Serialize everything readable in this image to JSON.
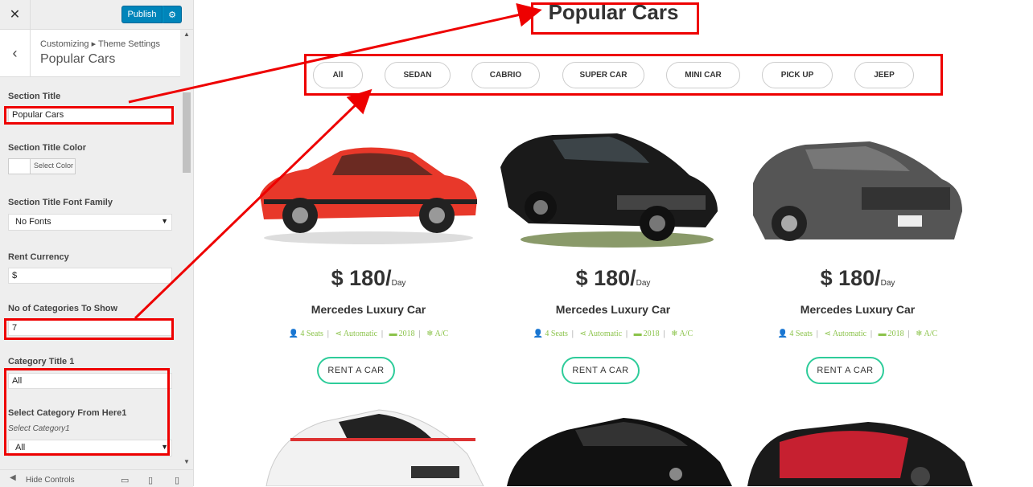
{
  "sidebar": {
    "close_icon": "close-icon",
    "publish_label": "Publish",
    "gear_icon": "gear-icon",
    "breadcrumb": "Customizing ▸ Theme Settings",
    "title": "Popular Cars",
    "fields": {
      "section_title_label": "Section Title",
      "section_title_value": "Popular Cars",
      "section_title_color_label": "Section Title Color",
      "select_color_label": "Select Color",
      "font_family_label": "Section Title Font Family",
      "font_family_value": "No Fonts",
      "rent_currency_label": "Rent Currency",
      "rent_currency_value": "$",
      "categories_label": "No of Categories To Show",
      "categories_value": "7",
      "category_title_label": "Category Title 1",
      "category_title_value": "All",
      "select_category_label": "Select Category From Here1",
      "select_category_sub": "Select Category1",
      "select_category_value": "All"
    },
    "footer": {
      "hide_controls": "Hide Controls"
    }
  },
  "main": {
    "title": "Popular Cars",
    "tabs": [
      "All",
      "SEDAN",
      "CABRIO",
      "SUPER CAR",
      "MINI CAR",
      "PICK UP",
      "JEEP"
    ],
    "cars": [
      {
        "price": "$ 180/",
        "unit": "Day",
        "name": "Mercedes Luxury Car",
        "seats": "4 Seats",
        "transmission": "Automatic",
        "year": "2018",
        "ac": "A/C",
        "button": "RENT A CAR",
        "color": "#e8382a"
      },
      {
        "price": "$ 180/",
        "unit": "Day",
        "name": "Mercedes Luxury Car",
        "seats": "4 Seats",
        "transmission": "Automatic",
        "year": "2018",
        "ac": "A/C",
        "button": "RENT A CAR",
        "color": "#1a1a1a"
      },
      {
        "price": "$ 180/",
        "unit": "Day",
        "name": "Mercedes Luxury Car",
        "seats": "4 Seats",
        "transmission": "Automatic",
        "year": "2018",
        "ac": "A/C",
        "button": "RENT A CAR",
        "color": "#555555"
      }
    ]
  },
  "colors": {
    "publish": "#0085ba",
    "annotation_red": "#ee0000",
    "rent_button_border": "#2ecc9a",
    "spec_green": "#8bc34a"
  }
}
